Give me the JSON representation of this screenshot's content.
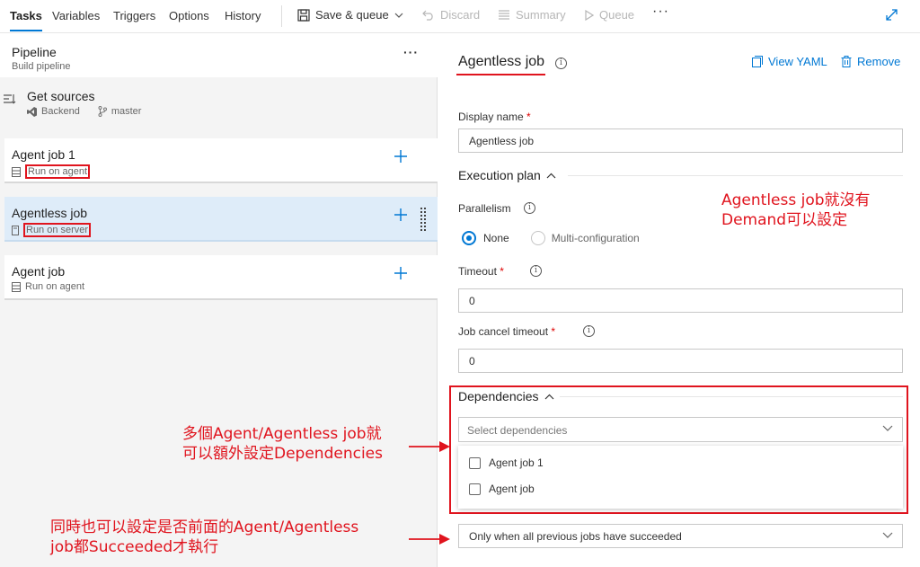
{
  "toolbar": {
    "tabs": [
      "Tasks",
      "Variables",
      "Triggers",
      "Options",
      "History"
    ],
    "save_queue": "Save & queue",
    "discard": "Discard",
    "summary": "Summary",
    "queue": "Queue",
    "more": "···"
  },
  "pipeline": {
    "title": "Pipeline",
    "subtitle": "Build pipeline",
    "more": "···"
  },
  "get_sources": {
    "title": "Get sources",
    "repo": "Backend",
    "branch": "master"
  },
  "jobs": [
    {
      "name": "Agent job 1",
      "run": "Run on agent"
    },
    {
      "name": "Agentless job",
      "run": "Run on server"
    },
    {
      "name": "Agent job",
      "run": "Run on agent"
    }
  ],
  "details": {
    "title": "Agentless job",
    "view_yaml": "View YAML",
    "remove": "Remove",
    "display_name_label": "Display name",
    "display_name_value": "Agentless job",
    "execution_plan": "Execution plan",
    "parallelism_label": "Parallelism",
    "parallelism_options": [
      "None",
      "Multi-configuration"
    ],
    "parallelism_selected": "None",
    "timeout_label": "Timeout",
    "timeout_value": "0",
    "cancel_timeout_label": "Job cancel timeout",
    "cancel_timeout_value": "0",
    "dependencies_label": "Dependencies",
    "dependencies_placeholder": "Select dependencies",
    "dependency_options": [
      "Agent job 1",
      "Agent job"
    ],
    "condition_value": "Only when all previous jobs have succeeded",
    "required_mark": "*"
  },
  "annotations": {
    "note1_line1": "Agentless job就沒有",
    "note1_line2": "Demand可以設定",
    "note2_line1": "多個Agent/Agentless job就",
    "note2_line2": "可以額外設定Dependencies",
    "note3_line1": "同時也可以設定是否前面的Agent/Agentless",
    "note3_line2": "job都Succeeded才執行",
    "color": "#e0141e"
  }
}
